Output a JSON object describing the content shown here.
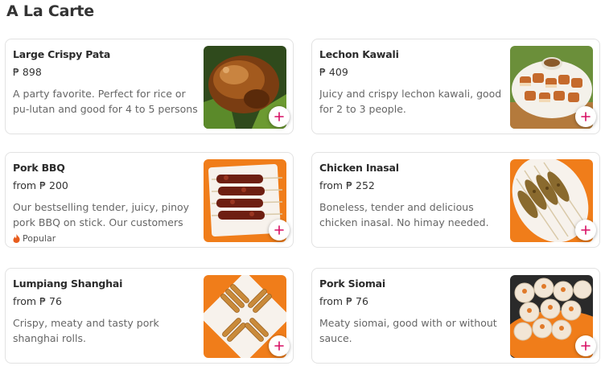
{
  "section": {
    "title": "A La Carte"
  },
  "colors": {
    "accent": "#d70f64",
    "popular_flame": "#e85d1e"
  },
  "items": [
    {
      "name": "Large Crispy Pata",
      "price": "₱ 898",
      "description": "A party favorite. Perfect for rice or pu-lutan and good for 4 to 5 persons",
      "badge": "",
      "image_icon": "crispy-pata-photo"
    },
    {
      "name": "Lechon Kawali",
      "price": "₱ 409",
      "description": "Juicy and crispy lechon kawali, good for 2 to 3 people.",
      "badge": "",
      "image_icon": "lechon-kawali-photo"
    },
    {
      "name": "Pork BBQ",
      "price": "from ₱ 200",
      "description": "Our bestselling tender, juicy, pinoy pork BBQ on stick. Our customers be...",
      "badge": "Popular",
      "image_icon": "pork-bbq-photo"
    },
    {
      "name": "Chicken Inasal",
      "price": "from ₱ 252",
      "description": "Boneless, tender and delicious chicken inasal. No himay needed.",
      "badge": "",
      "image_icon": "chicken-inasal-photo"
    },
    {
      "name": "Lumpiang Shanghai",
      "price": "from ₱ 76",
      "description": "Crispy, meaty and tasty pork shanghai rolls.",
      "badge": "",
      "image_icon": "lumpia-photo"
    },
    {
      "name": "Pork Siomai",
      "price": "from ₱ 76",
      "description": "Meaty siomai, good with or without sauce.",
      "badge": "",
      "image_icon": "siomai-photo"
    }
  ]
}
